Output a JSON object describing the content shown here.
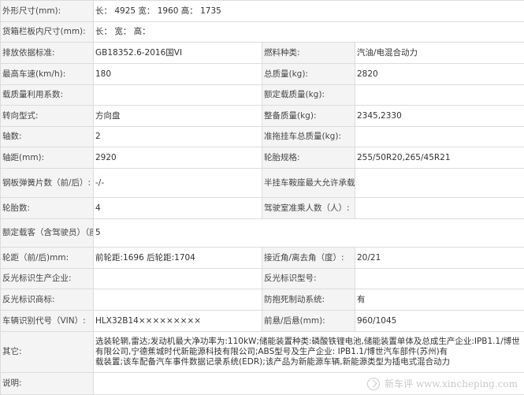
{
  "rows": {
    "exterior_size": {
      "label": "外形尺寸(mm):",
      "value": "长： 4925 宽： 1960 高： 1735"
    },
    "cargo_size": {
      "label": "货箱栏板内尺寸(mm):",
      "value": "长： 宽： 高："
    },
    "emission": {
      "label": "排放依据标准:",
      "value": "GB18352.6-2016国VI",
      "label2": "燃料种类:",
      "value2": "汽油/电混合动力"
    },
    "max_speed": {
      "label": "最高车速(km/h):",
      "value": "180",
      "label2": "总质量(kg):",
      "value2": "2820"
    },
    "load_util": {
      "label": "载质量利用系数:",
      "value": "",
      "label2": "额定载质量(kg):",
      "value2": ""
    },
    "steering": {
      "label": "转向型式:",
      "value": "方向盘",
      "label2": "整备质量(kg):",
      "value2": "2345,2330"
    },
    "axles": {
      "label": "轴数:",
      "value": "2",
      "label2": "准拖挂车总质量(kg):",
      "value2": ""
    },
    "wheelbase": {
      "label": "轴距(mm):",
      "value": "2920",
      "label2": "轮胎规格:",
      "value2": "255/50R20,265/45R21"
    },
    "springs": {
      "label": "钢板弹簧片数（前/后）:",
      "value": "-/-",
      "label2": "半挂车鞍座最大允许承载质量(kg):",
      "value2": ""
    },
    "tires": {
      "label": "轮胎数:",
      "value": "4",
      "label2": "驾驶室准乘人数（人）:",
      "value2": ""
    },
    "seats": {
      "label": "额定载客（含驾驶员）（座位数）:",
      "value": "5"
    },
    "track": {
      "label": "轮距（前/后)mm:",
      "value": "前轮距:1696 后轮距:1704",
      "label2": "接近角/离去角（度）:",
      "value2": "20/21"
    },
    "reflector_maker": {
      "label": "反光标识生产企业:",
      "value": "",
      "label2": "反光标识型号:",
      "value2": ""
    },
    "reflector_mark": {
      "label": "反光标识商标:",
      "value": "",
      "label2": "防抱死制动系统:",
      "value2": "有"
    },
    "vin": {
      "label": "车辆识别代号（VIN）:",
      "value": "HLX32B14×××××××××",
      "label2": "前悬/后悬(mm):",
      "value2": "960/1045"
    },
    "other": {
      "label": "其它:",
      "lines": [
        "选装轮辋,雷达;发动机最大净功率为:110kW;储能装置种类:磷酸铁锂电池,储能装置单体及总成生产企业:IPB1.1/博世汽车部件(苏州)有",
        "有限公司,宁德蕉城时代新能源科技有限公司;ABS型号及生产企业: IPB1.1/博世汽车部件(苏州)有",
        "载装置;该车配备汽车事件数据记录系统(EDR);该产品为新能源车辆,新能源类型为插电式混合动力"
      ]
    },
    "note": {
      "label": "说明:",
      "value": ""
    }
  },
  "watermark": {
    "text": "新车评 www.xincheping.com"
  }
}
